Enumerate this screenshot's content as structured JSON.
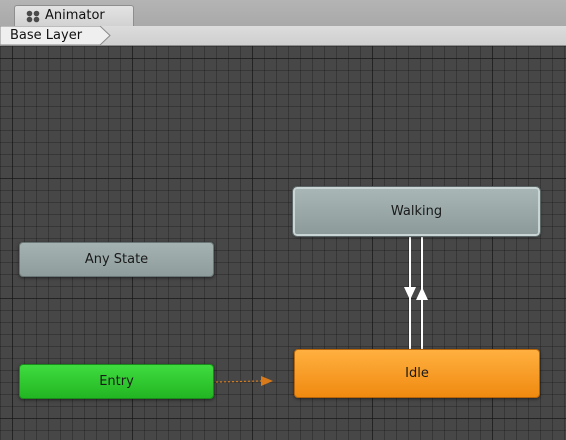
{
  "window": {
    "tab_label": "Animator",
    "tab_icon": "animator-icon"
  },
  "breadcrumb": {
    "layer_label": "Base Layer"
  },
  "graph": {
    "states": {
      "any_state": "Any State",
      "entry": "Entry",
      "walking": "Walking",
      "idle": "Idle"
    },
    "colors": {
      "entry": "#2ecc2e",
      "default_state": "#f59a1f",
      "state": "#9aa8a8",
      "entry_transition": "#d87a1a",
      "transition": "#ffffff",
      "grid_background": "#474747"
    }
  }
}
